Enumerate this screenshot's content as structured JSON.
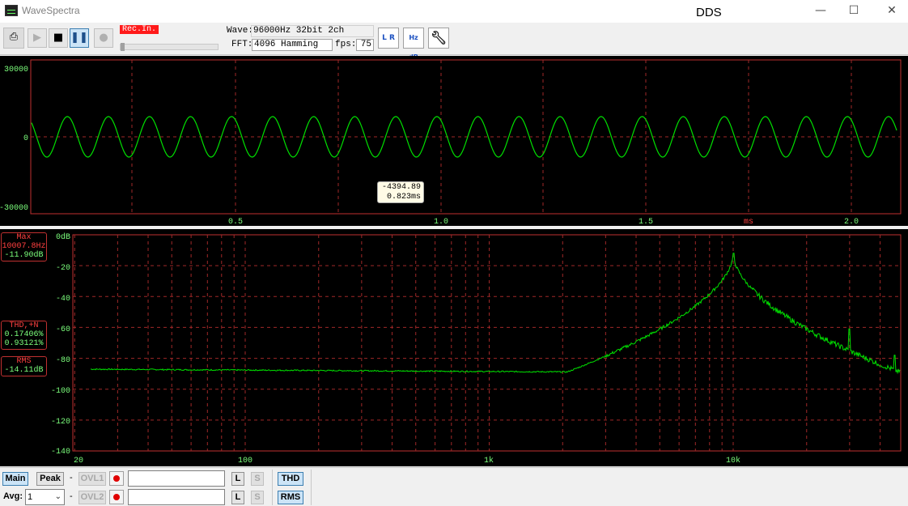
{
  "window": {
    "app_title": "WaveSpectra",
    "document_label": "DDS",
    "minimize_glyph": "—",
    "maximize_glyph": "☐",
    "close_glyph": "✕"
  },
  "toolbar": {
    "rec_in_label": "Rec.In.",
    "wave_label": "Wave:",
    "wave_value": "96000Hz 32bit 2ch",
    "fft_label": "FFT:",
    "fft_value": "4096 Hamming",
    "fps_label": "fps:",
    "fps_value": "75",
    "lr_icon_text": "L R",
    "hzdb_icon_text": "Hz dB",
    "icons": [
      "monitor-icon",
      "play-icon",
      "stop-icon",
      "pause-icon",
      "record-icon",
      "wrench-icon"
    ]
  },
  "waveform": {
    "y_ticks": [
      "30000",
      "0",
      "-30000"
    ],
    "x_ticks": [
      "0.5",
      "1.0",
      "1.5",
      "2.0"
    ],
    "x_unit": "ms",
    "cursor_value": "-4394.89",
    "cursor_time": "0.823ms",
    "color_trace": "#00ff00",
    "color_frame": "#c03030"
  },
  "spectrum": {
    "y_ticks": [
      "0dB",
      "-20",
      "-40",
      "-60",
      "-80",
      "-100",
      "-120",
      "-140"
    ],
    "x_ticks": [
      "20",
      "100",
      "1k",
      "10k"
    ],
    "max_title": "Max",
    "max_freq": "10007.8Hz",
    "max_level": "-11.90dB",
    "thd_title": "THD,+N",
    "thd_value": "0.17406%",
    "thdn_value": "0.93121%",
    "rms_title": "RMS",
    "rms_value": "-14.11dB"
  },
  "bottom": {
    "main_label": "Main",
    "peak_label": "Peak",
    "dash": "-",
    "ovl1_label": "OVL1",
    "ovl2_label": "OVL2",
    "l_label": "L",
    "s_label": "S",
    "avg_label": "Avg:",
    "avg_value": "1",
    "thd_button": "THD",
    "rms_button": "RMS"
  }
}
